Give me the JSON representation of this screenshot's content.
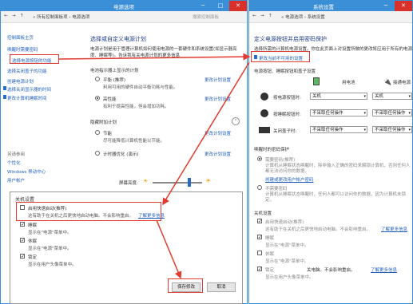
{
  "left_window": {
    "title": "电源选项",
    "breadcrumb": "« 所有控制面板项 › 电源选项",
    "search_placeholder": "搜索控制面板",
    "sidebar": {
      "home": "控制面板主页",
      "items": [
        "唤醒时需要密码",
        "选择电源按钮的功能",
        "选择关闭盖子的功能",
        "创建电源计划",
        "选择关闭显示器的时间",
        "更改计算机睡眠时间"
      ],
      "see_also_title": "另请参阅",
      "see_also": [
        "个性化",
        "Windows 移动中心",
        "用户帐户"
      ]
    },
    "main": {
      "title": "选择或自定义电源计划",
      "desc": "电源计划是用于管理计算机如何使用电源的一套硬件和系统设置(如显示器亮度、睡眠等)。告诉我有关电源计划的更多信息",
      "section_title": "电池指示器上显示的计划",
      "plans": [
        {
          "name": "平衡 (推荐)",
          "desc": "利用可用的硬件自动平衡功耗与性能。",
          "link": "更改计划设置"
        },
        {
          "name": "高性能",
          "desc": "有利于提高性能，但会增加功耗。",
          "link": "更改计划设置"
        }
      ],
      "hidden_title": "隐藏附加计划",
      "hidden_plans": [
        {
          "name": "节能",
          "desc": "尽可能降低计算机性能以节能。",
          "link": "更改计划设置"
        },
        {
          "name": "计时器优化 (演示)",
          "desc": "",
          "link": "更改计划设置"
        }
      ],
      "brightness_label": "屏幕亮度:"
    }
  },
  "shutdown_panel": {
    "title": "关机设置",
    "fast_startup": "启用快速启动(推荐)",
    "fast_startup_desc": "这有助于在关机之后更快地启动电脑。不会影响重启。",
    "learn_more": "了解更多信息",
    "sleep": "睡眠",
    "sleep_desc": "显示在\"电源\"菜单中。",
    "hibernate": "休眠",
    "hibernate_desc": "显示在\"电源\"菜单中。",
    "lock": "锁定",
    "lock_desc": "显示在用户头像菜单中。",
    "save_button": "保存修改",
    "cancel_button": "取消"
  },
  "right_window": {
    "title": "系统设置",
    "breadcrumb": "« 电源选项 › 系统设置",
    "main_title": "定义电源按钮并启用密码保护",
    "desc": "选择所需的计算机电源设置。你在此页面上对设置所做的更改将应用于所有的电源计划。",
    "change_unavailable": "更改当前不可用的设置",
    "section_title": "电源按钮、睡眠按钮和盖子设置",
    "col_battery": "用电池",
    "col_plugged": "接通电源",
    "rows": [
      {
        "label": "按电源按钮时:",
        "battery": "关机",
        "plugged": "关机"
      },
      {
        "label": "按睡眠按钮时:",
        "battery": "不采取任何操作",
        "plugged": "不采取任何操作"
      },
      {
        "label": "关闭盖子时:",
        "battery": "不采取任何操作",
        "plugged": "不采取任何操作"
      }
    ],
    "wake_title": "唤醒时的密码保护",
    "wake_opt1": "需要密码(推荐)",
    "wake_opt1_desc": "计算机从睡眠状态唤醒时，除非输入正确的密码来解锁计算机，否则任何人都无法访问你的数据。",
    "wake_opt1_link": "创建或更改用户帐户密码",
    "wake_opt2": "不需要密码",
    "wake_opt2_desc": "计算机从睡眠状态唤醒时，任何人都可以访问你的数据，因为计算机未锁定。",
    "shutdown_title": "关机设置",
    "items": [
      {
        "label": "启用快速启动(推荐)",
        "desc": "这有助于在关机之后更快地启动电脑。不会影响重启。",
        "link": "了解更多信息"
      },
      {
        "label": "睡眠",
        "desc": "显示在\"电源\"菜单中。"
      },
      {
        "label": "休眠",
        "desc": "显示在\"电源\"菜单中。"
      },
      {
        "label": "锁定",
        "desc": "显示在用户头像菜单中。"
      }
    ],
    "overlay_text": "关电脑。不会影响重启。",
    "overlay_link": "了解更多信息"
  }
}
